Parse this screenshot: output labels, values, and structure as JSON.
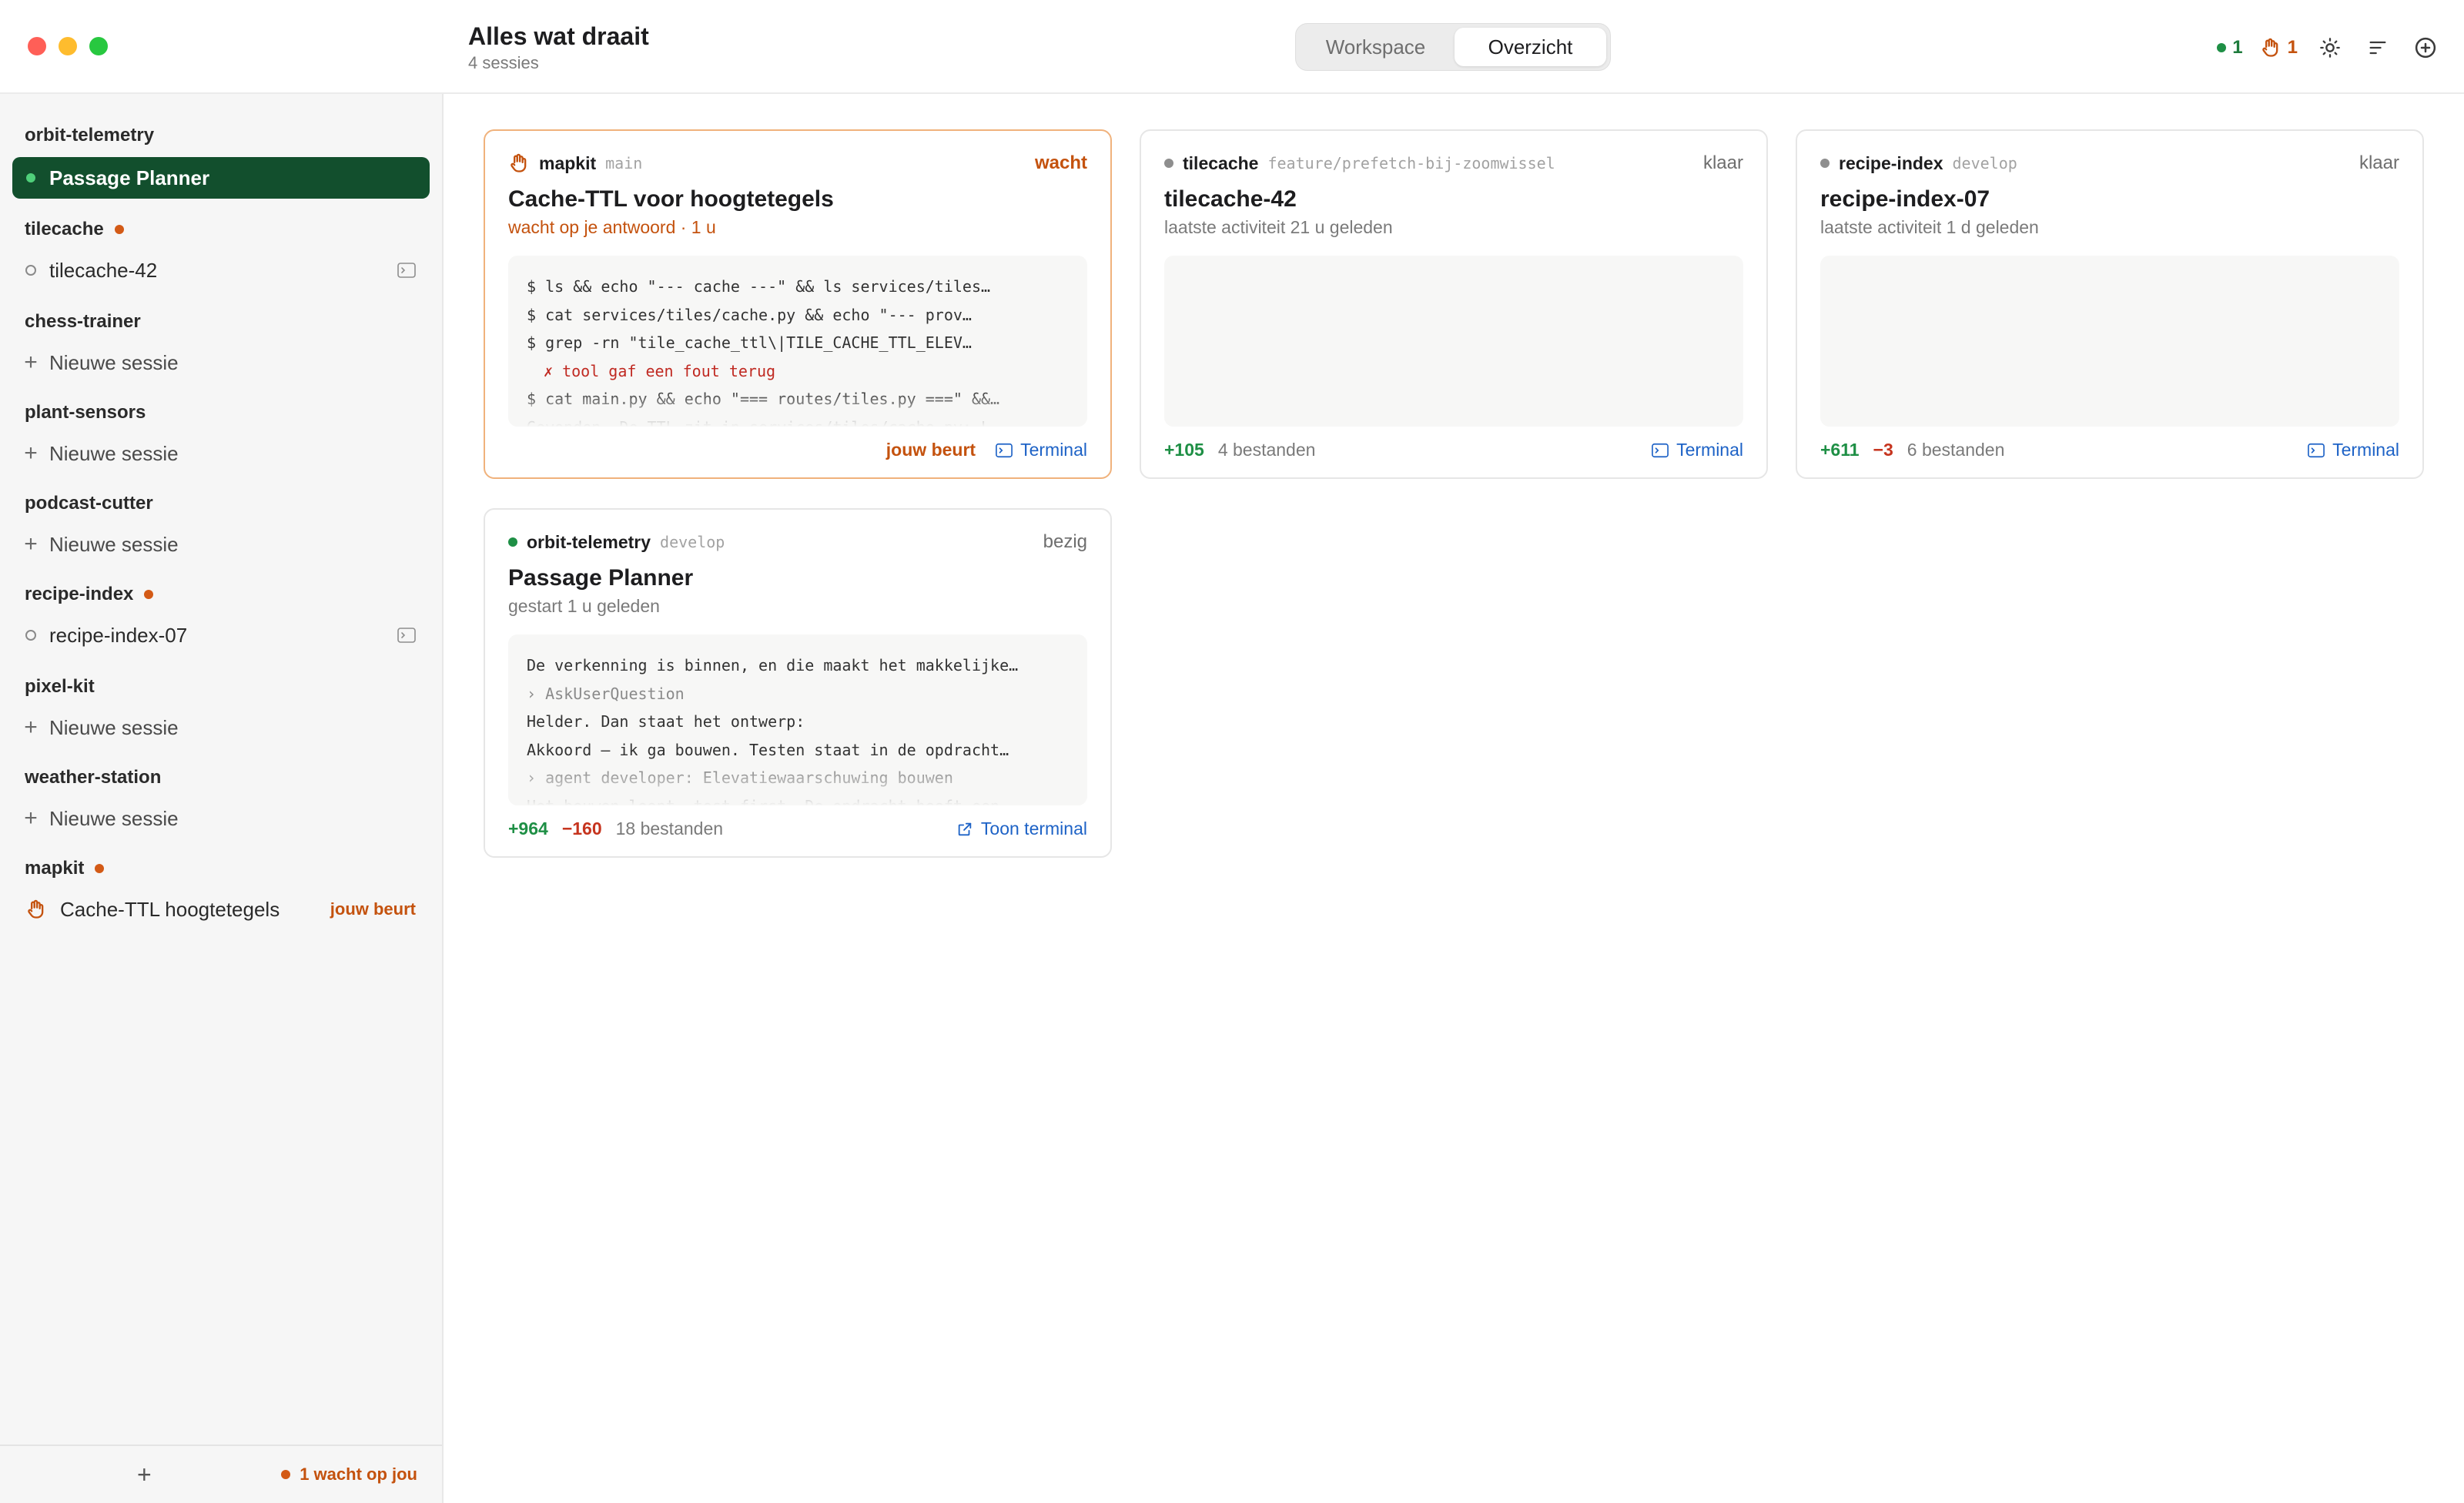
{
  "header": {
    "title": "Alles wat draait",
    "subtitle": "4 sessies",
    "tabs": [
      "Workspace",
      "Overzicht"
    ],
    "active_tab": "Overzicht",
    "running_count": "1",
    "waiting_count": "1"
  },
  "colors": {
    "accent_green": "#124f2d",
    "running_green": "#1e8f45",
    "attention_orange": "#c4520e",
    "link_blue": "#1d62c6",
    "deletions_red": "#c6341e"
  },
  "sidebar": {
    "projects": [
      {
        "name": "orbit-telemetry",
        "sessions": [
          {
            "label": "Passage Planner"
          }
        ]
      },
      {
        "name": "tilecache",
        "sessions": [
          {
            "label": "tilecache-42"
          }
        ]
      },
      {
        "name": "chess-trainer",
        "new_session": "Nieuwe sessie"
      },
      {
        "name": "plant-sensors",
        "new_session": "Nieuwe sessie"
      },
      {
        "name": "podcast-cutter",
        "new_session": "Nieuwe sessie"
      },
      {
        "name": "recipe-index",
        "sessions": [
          {
            "label": "recipe-index-07"
          }
        ]
      },
      {
        "name": "pixel-kit",
        "new_session": "Nieuwe sessie"
      },
      {
        "name": "weather-station",
        "new_session": "Nieuwe sessie"
      },
      {
        "name": "mapkit",
        "sessions": [
          {
            "label": "Cache-TTL hoogtetegels",
            "badge": "jouw beurt"
          }
        ]
      }
    ],
    "footer": {
      "add": "+",
      "waiting": "1 wacht op jou"
    }
  },
  "cards": [
    {
      "project": "mapkit",
      "branch": "main",
      "status": "wacht",
      "title": "Cache-TTL voor hoogtetegels",
      "subtitle": "wacht op je antwoord · 1 u",
      "log": [
        "$ ls && echo \"--- cache ---\" && ls services/tiles…",
        "$ cat services/tiles/cache.py && echo \"--- prov…",
        "$ grep -rn \"tile_cache_ttl\\|TILE_CACHE_TTL_ELEV…",
        "✗ tool gaf een fout terug",
        "$ cat main.py && echo \"=== routes/tiles.py ===\" &&…",
        "Gevonden. De TTL zit in services/tiles/cache.py: L…"
      ],
      "turn_label": "jouw beurt",
      "terminal_label": "Terminal"
    },
    {
      "project": "tilecache",
      "branch": "feature/prefetch-bij-zoomwissel",
      "status": "klaar",
      "title": "tilecache-42",
      "subtitle": "laatste activiteit 21 u geleden",
      "additions": "+105",
      "files": "4 bestanden",
      "terminal_label": "Terminal"
    },
    {
      "project": "recipe-index",
      "branch": "develop",
      "status": "klaar",
      "title": "recipe-index-07",
      "subtitle": "laatste activiteit 1 d geleden",
      "additions": "+611",
      "deletions": "−3",
      "files": "6 bestanden",
      "terminal_label": "Terminal"
    },
    {
      "project": "orbit-telemetry",
      "branch": "develop",
      "status": "bezig",
      "title": "Passage Planner",
      "subtitle": "gestart 1 u geleden",
      "log": [
        "De verkenning is binnen, en die maakt het makkelijke…",
        "› AskUserQuestion",
        "Helder. Dan staat het ontwerp:",
        "Akkoord — ik ga bouwen. Testen staat in de opdracht…",
        "› agent developer: Elevatiewaarschuwing bouwen",
        "Het bouwen loopt, test-first. De opdracht heeft een…"
      ],
      "additions": "+964",
      "deletions": "−160",
      "files": "18 bestanden",
      "terminal_label": "Toon terminal"
    }
  ]
}
